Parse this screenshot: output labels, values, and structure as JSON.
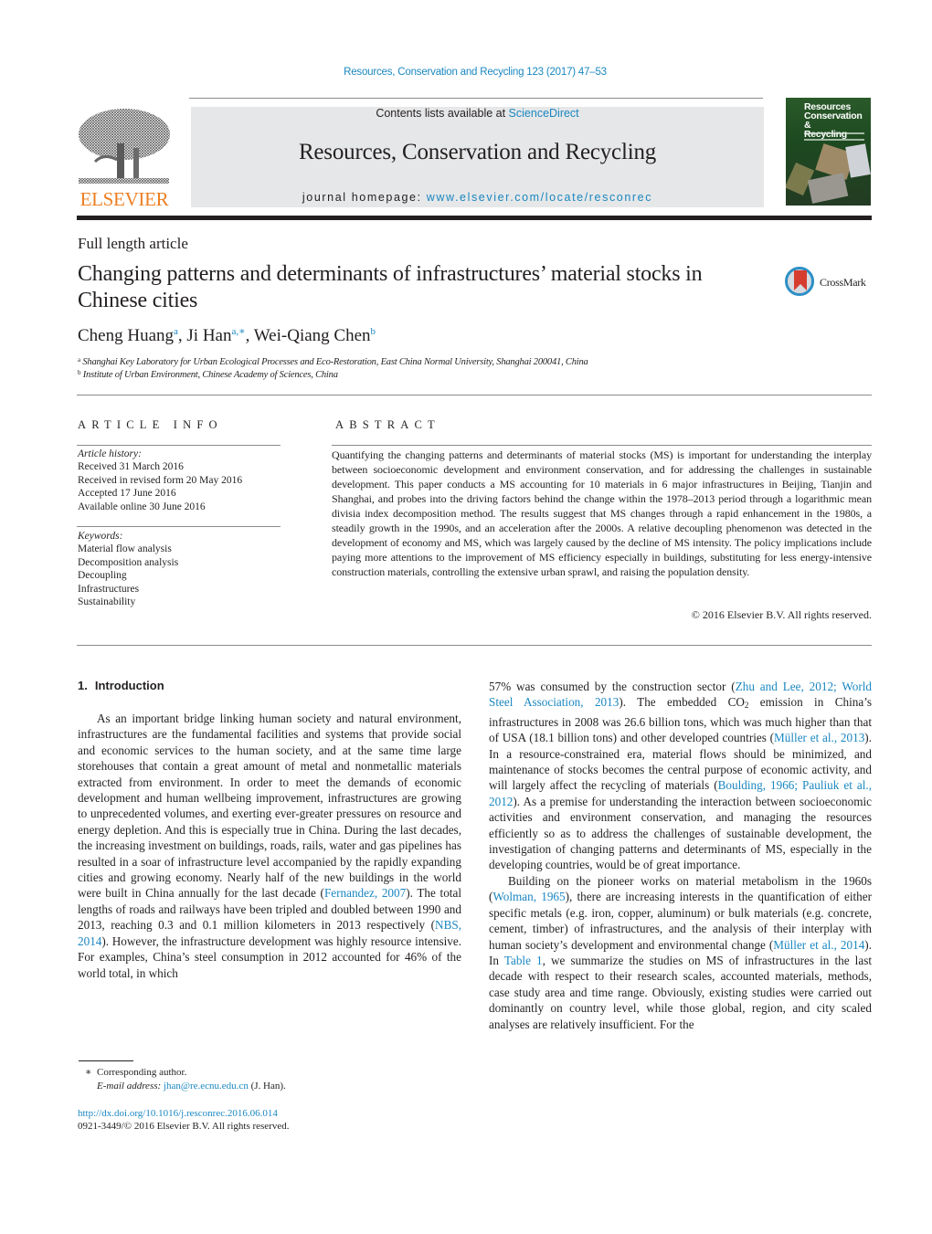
{
  "header": {
    "journal_reference": "Resources, Conservation and Recycling 123 (2017) 47–53",
    "contents_prefix": "Contents lists available at ",
    "contents_link": "ScienceDirect",
    "journal_title": "Resources, Conservation and Recycling",
    "homepage_prefix": "journal homepage: ",
    "homepage_link": "www.elsevier.com/locate/resconrec",
    "publisher_logo_text": "ELSEVIER",
    "cover_title": "Resources Conservation & Recycling",
    "cover_title_lines": [
      "Resources",
      "Conservation &",
      "Recycling"
    ],
    "colors": {
      "link": "#1a87c1",
      "publisher_orange": "#ed7e21",
      "banner_bg": "#e6e7e8"
    }
  },
  "article": {
    "type": "Full length article",
    "title": "Changing patterns and determinants of infrastructures’ material stocks in Chinese cities",
    "crossmark_label": "CrossMark",
    "authors": [
      {
        "name": "Cheng Huang",
        "affil": "a"
      },
      {
        "name": "Ji Han",
        "affil": "a,∗"
      },
      {
        "name": "Wei-Qiang Chen",
        "affil": "b"
      }
    ],
    "affiliations": [
      {
        "key": "a",
        "text": "Shanghai Key Laboratory for Urban Ecological Processes and Eco-Restoration, East China Normal University, Shanghai 200041, China"
      },
      {
        "key": "b",
        "text": "Institute of Urban Environment, Chinese Academy of Sciences, China"
      }
    ]
  },
  "article_info": {
    "heading": "ARTICLE INFO",
    "history_label": "Article history:",
    "history": [
      "Received 31 March 2016",
      "Received in revised form 20 May 2016",
      "Accepted 17 June 2016",
      "Available online 30 June 2016"
    ],
    "keywords_label": "Keywords:",
    "keywords": [
      "Material flow analysis",
      "Decomposition analysis",
      "Decoupling",
      "Infrastructures",
      "Sustainability"
    ]
  },
  "abstract": {
    "heading": "ABSTRACT",
    "text": "Quantifying the changing patterns and determinants of material stocks (MS) is important for understanding the interplay between socioeconomic development and environment conservation, and for addressing the challenges in sustainable development. This paper conducts a MS accounting for 10 materials in 6 major infrastructures in Beijing, Tianjin and Shanghai, and probes into the driving factors behind the change within the 1978–2013 period through a logarithmic mean divisia index decomposition method. The results suggest that MS changes through a rapid enhancement in the 1980s, a steadily growth in the 1990s, and an acceleration after the 2000s. A relative decoupling phenomenon was detected in the development of economy and MS, which was largely caused by the decline of MS intensity. The policy implications include paying more attentions to the improvement of MS efficiency especially in buildings, substituting for less energy-intensive construction materials, controlling the extensive urban sprawl, and raising the population density.",
    "copyright": "© 2016 Elsevier B.V. All rights reserved."
  },
  "body": {
    "section_number": "1.",
    "section_title": "Introduction",
    "p1": {
      "t1": "As an important bridge linking human society and natural environment, infrastructures are the fundamental facilities and systems that provide social and economic services to the human society, and at the same time large storehouses that contain a great amount of metal and nonmetallic materials extracted from environment. In order to meet the demands of economic development and human wellbeing improvement, infrastructures are growing to unprecedented volumes, and exerting ever-greater pressures on resource and energy depletion. And this is especially true in China. During the last decades, the increasing investment on buildings, roads, rails, water and gas pipelines has resulted in a soar of infrastructure level accompanied by the rapidly expanding cities and growing economy. Nearly half of the new buildings in the world were built in China annually for the last decade (",
      "c1": "Fernandez, 2007",
      "t2": "). The total lengths of roads and railways have been tripled and doubled between 1990 and 2013, reaching 0.3 and 0.1 million kilometers in 2013 respectively (",
      "c2": "NBS, 2014",
      "t3": "). However, the infrastructure development was highly resource intensive. For examples, China’s steel consumption in 2012 accounted for 46% of the world total, in which 57% was consumed by the construction sector (",
      "c3": "Zhu and Lee, 2012; World Steel Association, 2013",
      "t4": "). The embedded CO",
      "t4_sub": "2",
      "t5": " emission in China’s infrastructures in 2008 was 26.6 billion tons, which was much higher than that of USA (18.1 billion tons) and other developed countries (",
      "c4": "Müller et al., 2013",
      "t6": "). In a resource-constrained era, material flows should be minimized, and maintenance of stocks becomes the central purpose of economic activity, and will largely affect the recycling of materials (",
      "c5": "Boulding, 1966; Pauliuk et al., 2012",
      "t7": "). As a premise for understanding the interaction between socioeconomic activities and environment conservation, and managing the resources efficiently so as to address the challenges of sustainable development, the investigation of changing patterns and determinants of MS, especially in the developing countries, would be of great importance."
    },
    "p2": {
      "t1": "Building on the pioneer works on material metabolism in the 1960s (",
      "c1": "Wolman, 1965",
      "t2": "), there are increasing interests in the quantification of either specific metals (e.g. iron, copper, aluminum) or bulk materials (e.g. concrete, cement, timber) of infrastructures, and the analysis of their interplay with human society’s development and environmental change (",
      "c2": "Müller et al., 2014",
      "t3": "). In ",
      "c3": "Table 1",
      "t4": ", we summarize the studies on MS of infrastructures in the last decade with respect to their research scales, accounted materials, methods, case study area and time range. Obviously, existing studies were carried out dominantly on country level, while those global, region, and city scaled analyses are relatively insufficient. For the"
    }
  },
  "footnotes": {
    "corresponding_mark": "∗",
    "corresponding": "Corresponding author.",
    "email_label": "E-mail address:",
    "email": "jhan@re.ecnu.edu.cn",
    "email_suffix": " (J. Han).",
    "doi": "http://dx.doi.org/10.1016/j.resconrec.2016.06.014",
    "issn": "0921-3449/© 2016 Elsevier B.V. All rights reserved."
  }
}
